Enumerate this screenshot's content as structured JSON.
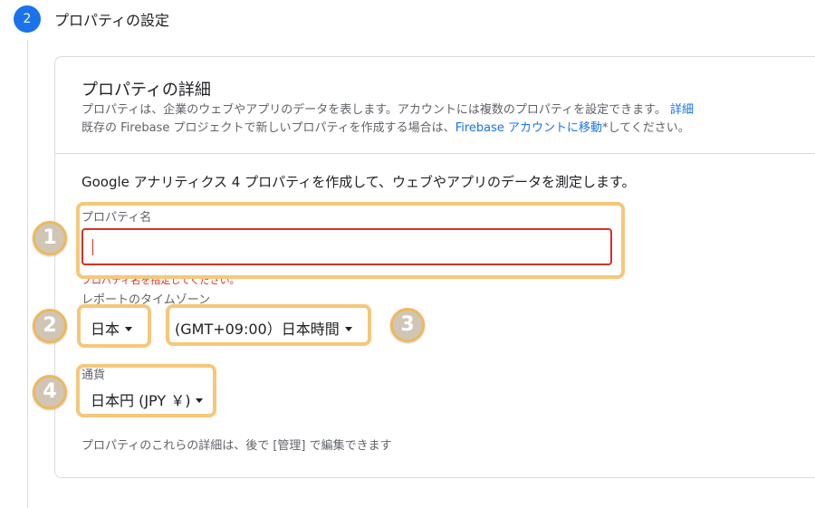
{
  "step": {
    "number": "2",
    "title": "プロパティの設定"
  },
  "details_card": {
    "title": "プロパティの詳細",
    "desc_line1": "プロパティは、企業のウェブやアプリのデータを表します。アカウントには複数のプロパティを設定できます。",
    "desc_link1": "詳細",
    "desc_line2_prefix": "既存の Firebase プロジェクトで新しいプロパティを作成する場合は、",
    "desc_link2": "Firebase アカウントに移動",
    "desc_line2_suffix": "*してください。"
  },
  "intro_text": "Google アナリティクス 4 プロパティを作成して、ウェブやアプリのデータを測定します。",
  "property_name": {
    "label": "プロパティ名",
    "value": "",
    "error": "プロパティ名を指定してください。"
  },
  "timezone": {
    "label": "レポートのタイムゾーン",
    "country": "日本",
    "zone": "(GMT+09:00）日本時間"
  },
  "currency": {
    "label": "通貨",
    "value": "日本円 (JPY ￥)"
  },
  "footer_note": "プロパティのこれらの詳細は、後で [管理] で編集できます",
  "annotations": {
    "badge1": "1",
    "badge2": "2",
    "badge3": "3",
    "badge4": "4",
    "highlight_color": "#f6c779"
  },
  "colors": {
    "accent": "#1a73e8",
    "error": "#d93025"
  }
}
